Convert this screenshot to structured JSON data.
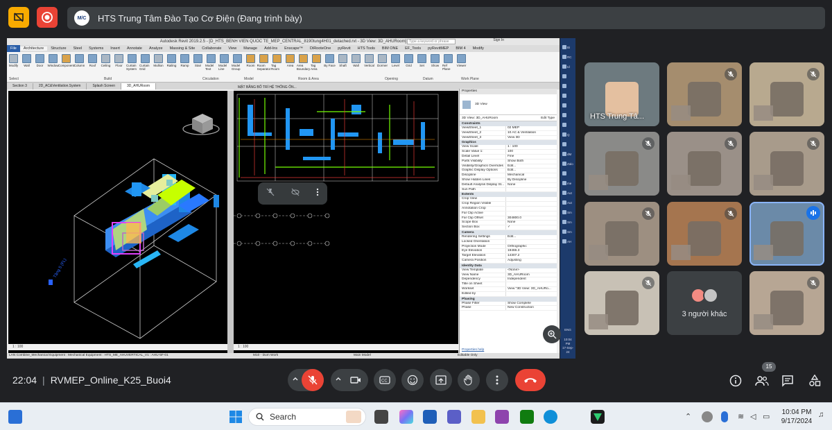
{
  "meeting": {
    "presenting_title": "HTS Trung Tâm Đào Tạo Cơ Điện (Đang trình bày)",
    "logo_text": "M/C",
    "time": "22:04",
    "meeting_code": "RVMEP_Online_K25_Buoi4",
    "participants_count": "15"
  },
  "revit": {
    "title": "Autodesk Revit 2019.2.5 - [D_HTS_BENH VIEN QUOC TE_MEP_CENTRAL_8190tung4H01_detached.rvt - 3D View: 3D_AHURoom]",
    "search_placeholder": "Type a keyword or phrase",
    "sign_in": "Sign In",
    "tabs": [
      "File",
      "Architecture",
      "Structure",
      "Steel",
      "Systems",
      "Insert",
      "Annotate",
      "Analyze",
      "Massing & Site",
      "Collaborate",
      "View",
      "Manage",
      "Add-Ins",
      "Enscape™",
      "DiRooteOne",
      "pyRevit",
      "HTS Tools",
      "BIM ONE",
      "EF_Tools",
      "pyRevitMEP",
      "BIM 4",
      "Modify"
    ],
    "ribbon_buttons": [
      "Modify",
      "Wall",
      "Door",
      "Window",
      "Component",
      "Column",
      "Roof",
      "Ceiling",
      "Floor",
      "Curtain System",
      "Curtain Grid",
      "Mullion",
      "Railing",
      "Ramp",
      "Stair",
      "Model Text",
      "Model Line",
      "Model Group",
      "Room",
      "Room Separator",
      "Tag Room",
      "Area",
      "Area Boundary",
      "Tag Area",
      "By Face",
      "Shaft",
      "Wall",
      "Vertical",
      "Dormer",
      "Level",
      "Grid",
      "Set",
      "Show",
      "Ref Plane",
      "Viewer"
    ],
    "ribbon_groups": [
      "Select",
      "Build",
      "Circulation",
      "Model",
      "Room & Area",
      "Opening",
      "Datum",
      "Work Plane"
    ],
    "view_tabs": [
      "Section 3",
      "2D_AC&Ventilation.System",
      "Splash Screen",
      "3D_AHURoom"
    ],
    "plan_tab": "MẶT BẰNG BỐ TRÍ HỆ THỐNG ỐN...",
    "view_scale_3d": "1 : 100",
    "view_scale_plan": "1 : 100",
    "status_bar": "LAN Combine_Mechanical Equipment : Mechanical Equipment : HTS_ME_AHUVERTICAL_V1 : AHU-5F-01",
    "workset": "M10 - Dum Work",
    "main_model": "Main Model",
    "editable_only": "Editable Only",
    "level_label": "Tầng 5 (FL)",
    "properties": {
      "header": "Properties",
      "type": "3D View",
      "selector": "3D View: 3D_AHURoom",
      "edit_type": "Edit Type",
      "sections": [
        {
          "name": "Constraints",
          "rows": [
            [
              "ViewSheet_1",
              "02 MEP"
            ],
            [
              "ViewSheet_2",
              "10 AC & Ventilation"
            ],
            [
              "ViewSheet_3",
              "View 3D"
            ]
          ]
        },
        {
          "name": "Graphics",
          "rows": [
            [
              "View Scale",
              "1 : 100"
            ],
            [
              "Scale Value 1:",
              "100"
            ],
            [
              "Detail Level",
              "Fine"
            ],
            [
              "Parts Visibility",
              "Show Both"
            ],
            [
              "Visibility/Graphics Overrides",
              "Edit..."
            ],
            [
              "Graphic Display Options",
              "Edit..."
            ],
            [
              "Discipline",
              "Mechanical"
            ],
            [
              "Show Hidden Lines",
              "By Discipline"
            ],
            [
              "Default Analysis Display St...",
              "None"
            ],
            [
              "Sun Path",
              ""
            ]
          ]
        },
        {
          "name": "Extents",
          "rows": [
            [
              "Crop View",
              ""
            ],
            [
              "Crop Region Visible",
              ""
            ],
            [
              "Annotation Crop",
              ""
            ],
            [
              "Far Clip Active",
              ""
            ],
            [
              "Far Clip Offset",
              "304800.0"
            ],
            [
              "Scope Box",
              "None"
            ],
            [
              "Section Box",
              "✓"
            ]
          ]
        },
        {
          "name": "Camera",
          "rows": [
            [
              "Rendering Settings",
              "Edit..."
            ],
            [
              "Locked Orientation",
              ""
            ],
            [
              "Projection Mode",
              "Orthographic"
            ],
            [
              "Eye Elevation",
              "19466.3"
            ],
            [
              "Target Elevation",
              "14307.2"
            ],
            [
              "Camera Position",
              "Adjusting"
            ]
          ]
        },
        {
          "name": "Identity Data",
          "rows": [
            [
              "View Template",
              "<None>"
            ],
            [
              "View Name",
              "3D_AHURoom"
            ],
            [
              "Dependency",
              "Independent"
            ],
            [
              "Title on Sheet",
              ""
            ],
            [
              "Workset",
              "View \"3D View: 3D_AHURo..."
            ],
            [
              "Edited by",
              ""
            ]
          ]
        },
        {
          "name": "Phasing",
          "rows": [
            [
              "Phase Filter",
              "Show Complete"
            ],
            [
              "Phase",
              "New Construction"
            ]
          ]
        }
      ],
      "help": "Properties help"
    }
  },
  "shared_taskbar": {
    "items": [
      "Bi",
      "RC",
      "Id",
      "",
      "",
      "",
      "",
      "",
      "",
      "Q",
      "",
      "dM",
      "Zalo",
      "",
      "me",
      "Aut",
      "Aut",
      "Sm",
      "Sm",
      "Sm",
      "AH"
    ],
    "lang": "ENG",
    "time": "10:04 PM",
    "date": "17-Sep-24"
  },
  "participants": [
    {
      "name": "HTS Trung Tâ...",
      "muted": false
    },
    {
      "name": "",
      "muted": true
    },
    {
      "name": "",
      "muted": true
    },
    {
      "name": "",
      "muted": true
    },
    {
      "name": "",
      "muted": true
    },
    {
      "name": "",
      "muted": true
    },
    {
      "name": "",
      "muted": true
    },
    {
      "name": "",
      "muted": true
    },
    {
      "name": "",
      "speaking": true
    },
    {
      "name": "",
      "muted": true
    },
    {
      "name": "",
      "muted": true
    }
  ],
  "others_label": "3 người khác",
  "taskbar": {
    "search": "Search",
    "time": "10:04 PM",
    "date": "9/17/2024"
  },
  "colors": {
    "meet_bg": "#202124",
    "pill": "#3c4043",
    "danger": "#ea4335",
    "accent": "#1a73e8",
    "warning": "#f9ab00"
  }
}
